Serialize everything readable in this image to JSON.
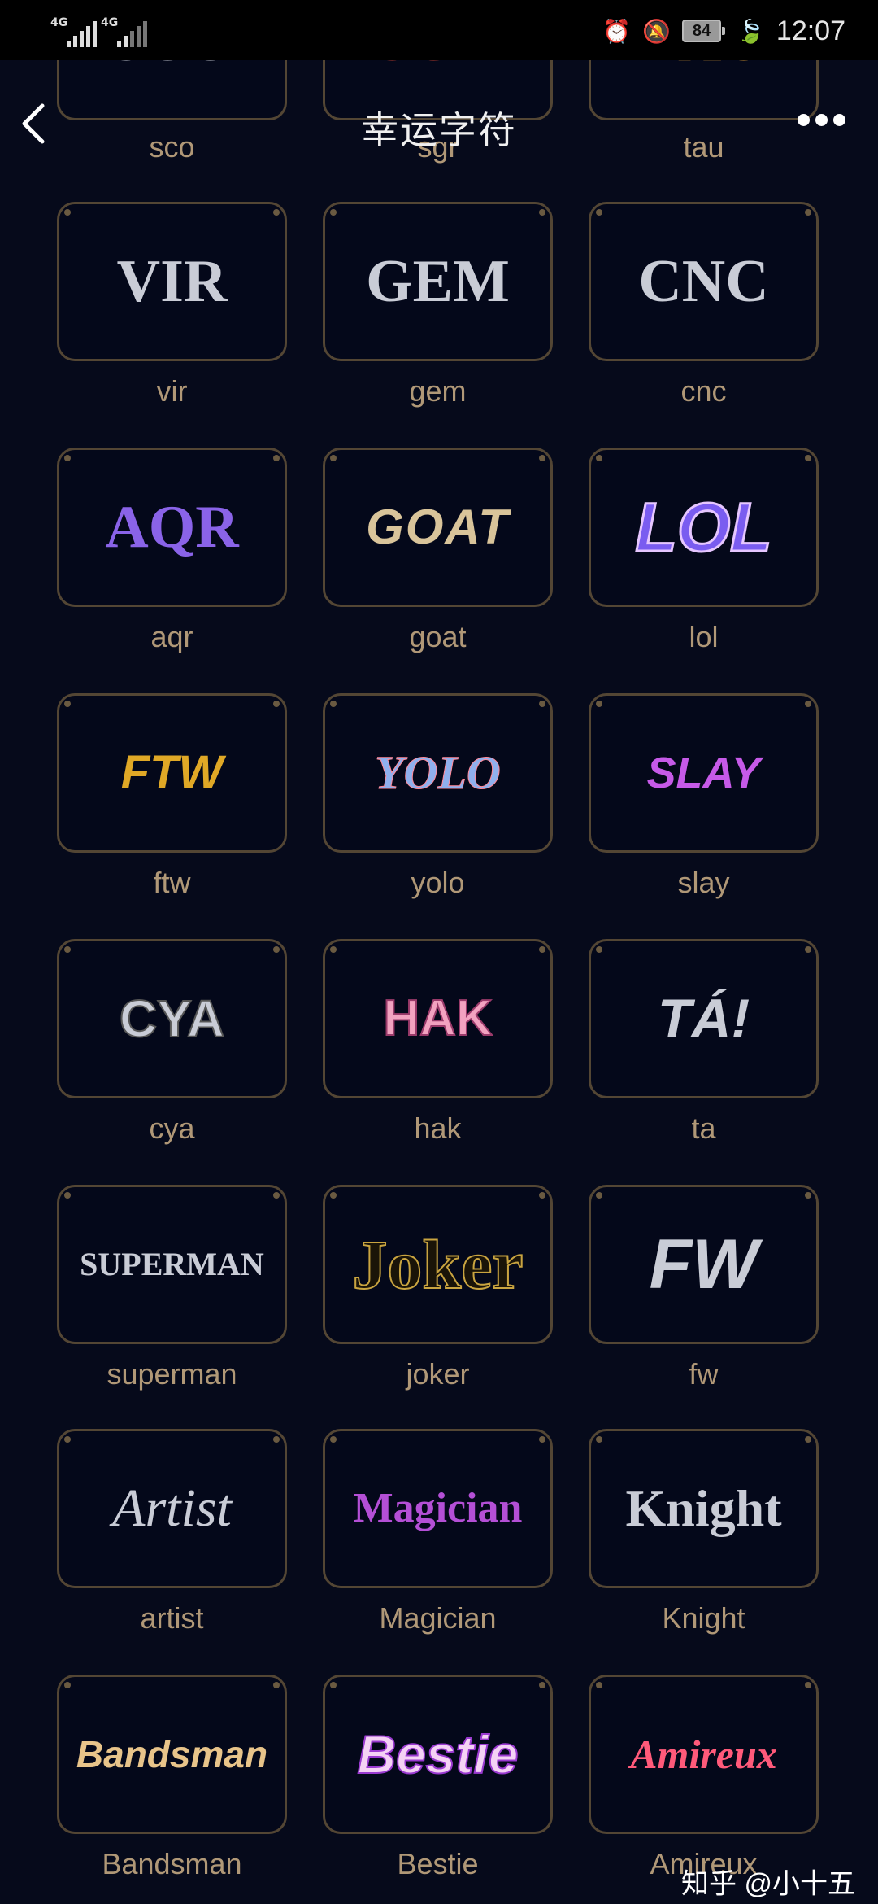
{
  "status_bar": {
    "network_1": "4G",
    "network_2": "4G",
    "battery": "84",
    "time": "12:07"
  },
  "header": {
    "title": "幸运字符"
  },
  "cards": [
    {
      "art": "SCO",
      "label": "sco"
    },
    {
      "art": "SGR",
      "label": "sgr"
    },
    {
      "art": "TAU",
      "label": "tau"
    },
    {
      "art": "VIR",
      "label": "vir"
    },
    {
      "art": "GEM",
      "label": "gem"
    },
    {
      "art": "CNC",
      "label": "cnc"
    },
    {
      "art": "AQR",
      "label": "aqr"
    },
    {
      "art": "GOAT",
      "label": "goat"
    },
    {
      "art": "LOL",
      "label": "lol"
    },
    {
      "art": "FTW",
      "label": "ftw"
    },
    {
      "art": "YOLO",
      "label": "yolo"
    },
    {
      "art": "SLAY",
      "label": "slay"
    },
    {
      "art": "CYA",
      "label": "cya"
    },
    {
      "art": "HAK",
      "label": "hak"
    },
    {
      "art": "TÁ!",
      "label": "ta"
    },
    {
      "art": "SUPERMAN",
      "label": "superman"
    },
    {
      "art": "Joker",
      "label": "joker"
    },
    {
      "art": "FW",
      "label": "fw"
    },
    {
      "art": "Artist",
      "label": "artist"
    },
    {
      "art": "Magician",
      "label": "Magician"
    },
    {
      "art": "Knight",
      "label": "Knight"
    },
    {
      "art": "Bandsman",
      "label": "Bandsman"
    },
    {
      "art": "Bestie",
      "label": "Bestie"
    },
    {
      "art": "Amireux",
      "label": "Amireux"
    }
  ],
  "watermark": "知乎 @小十五",
  "colors": {
    "background": "#060a1b",
    "card_border": "#534634",
    "label": "#b09877"
  }
}
